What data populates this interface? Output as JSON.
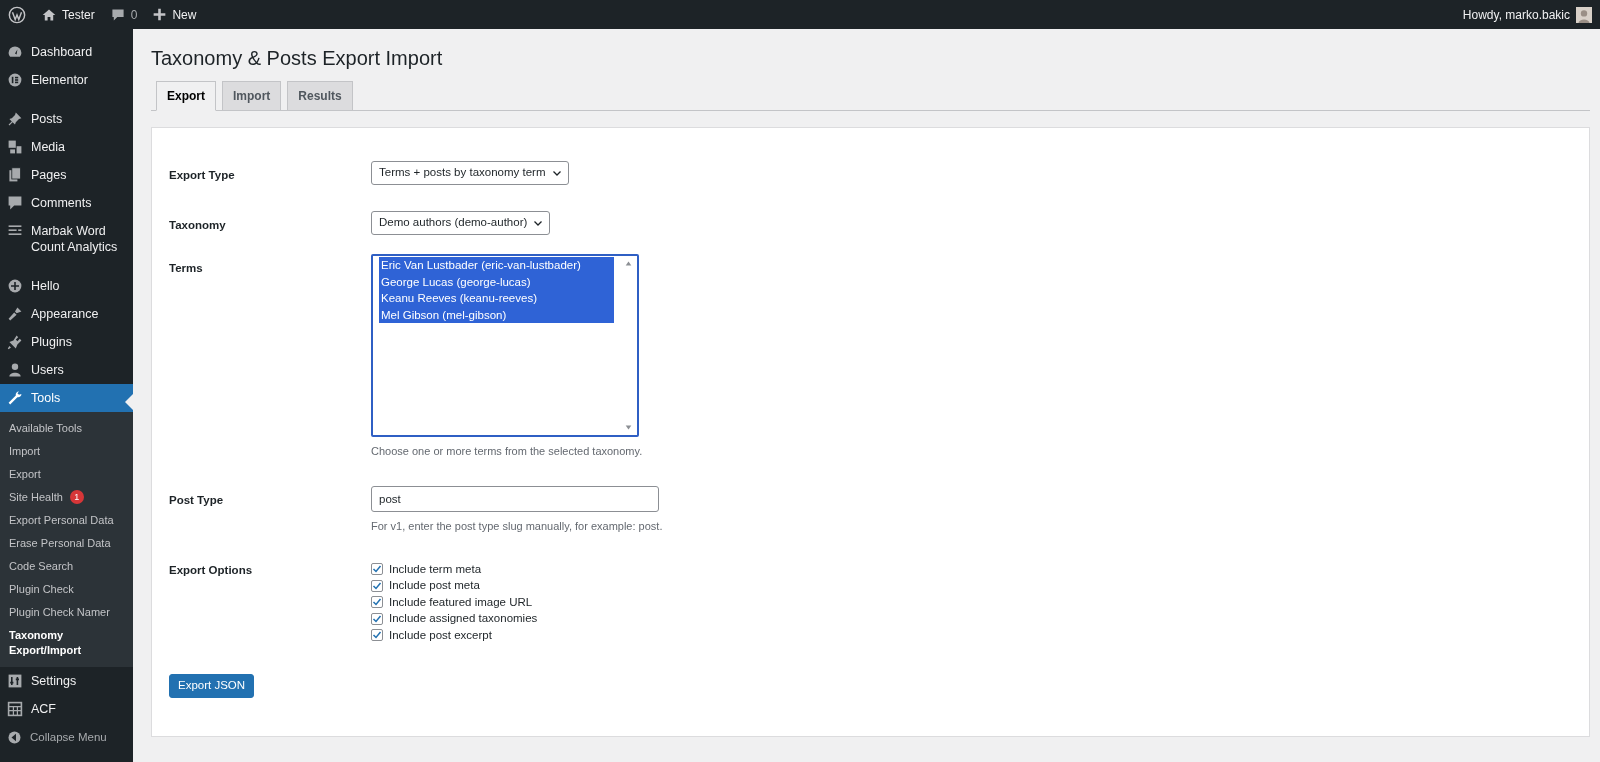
{
  "admin_bar": {
    "site": "Tester",
    "comments": "0",
    "new": "New",
    "greeting": "Howdy, marko.bakic"
  },
  "sidebar": {
    "groups": [
      [
        {
          "label": "Dashboard",
          "selected": false
        },
        {
          "label": "Elementor",
          "selected": false
        }
      ],
      [
        {
          "label": "Posts",
          "selected": false
        },
        {
          "label": "Media",
          "selected": false
        },
        {
          "label": "Pages",
          "selected": false
        },
        {
          "label": "Comments",
          "selected": false
        },
        {
          "label": "Marbak Word Count Analytics",
          "selected": false
        }
      ],
      [
        {
          "label": "Hello",
          "selected": false
        },
        {
          "label": "Appearance",
          "selected": false
        },
        {
          "label": "Plugins",
          "selected": false
        },
        {
          "label": "Users",
          "selected": false
        },
        {
          "label": "Tools",
          "selected": true,
          "children": [
            {
              "label": "Available Tools",
              "selected": false
            },
            {
              "label": "Import",
              "selected": false
            },
            {
              "label": "Export",
              "selected": false
            },
            {
              "label": "Site Health",
              "selected": false,
              "badge": "1"
            },
            {
              "label": "Export Personal Data",
              "selected": false
            },
            {
              "label": "Erase Personal Data",
              "selected": false
            },
            {
              "label": "Code Search",
              "selected": false
            },
            {
              "label": "Plugin Check",
              "selected": false
            },
            {
              "label": "Plugin Check Namer",
              "selected": false
            },
            {
              "label": "Taxonomy Export/Import",
              "selected": true
            }
          ]
        },
        {
          "label": "Settings",
          "selected": false
        },
        {
          "label": "ACF",
          "selected": false
        }
      ]
    ],
    "collapse": "Collapse Menu"
  },
  "page_title": "Taxonomy & Posts Export Import",
  "tabs": [
    {
      "label": "Export",
      "selected": true
    },
    {
      "label": "Import",
      "selected": false
    },
    {
      "label": "Results",
      "selected": false
    }
  ],
  "form": {
    "export_type": {
      "label": "Export Type",
      "value": "Terms + posts by taxonomy term"
    },
    "taxonomy": {
      "label": "Taxonomy",
      "value": "Demo authors (demo-author)"
    },
    "terms": {
      "label": "Terms",
      "options": [
        {
          "label": "Eric Van Lustbader (eric-van-lustbader)",
          "selected": true
        },
        {
          "label": "George Lucas (george-lucas)",
          "selected": true
        },
        {
          "label": "Keanu Reeves (keanu-reeves)",
          "selected": true
        },
        {
          "label": "Mel Gibson (mel-gibson)",
          "selected": true
        }
      ],
      "help": "Choose one or more terms from the selected taxonomy."
    },
    "post_type": {
      "label": "Post Type",
      "value": "post",
      "help": "For v1, enter the post type slug manually, for example: post."
    },
    "export_options": {
      "label": "Export Options",
      "options": [
        {
          "label": "Include term meta",
          "checked": true
        },
        {
          "label": "Include post meta",
          "checked": true
        },
        {
          "label": "Include featured image URL",
          "checked": true
        },
        {
          "label": "Include assigned taxonomies",
          "checked": true
        },
        {
          "label": "Include post excerpt",
          "checked": true
        }
      ]
    },
    "button": "Export JSON"
  }
}
